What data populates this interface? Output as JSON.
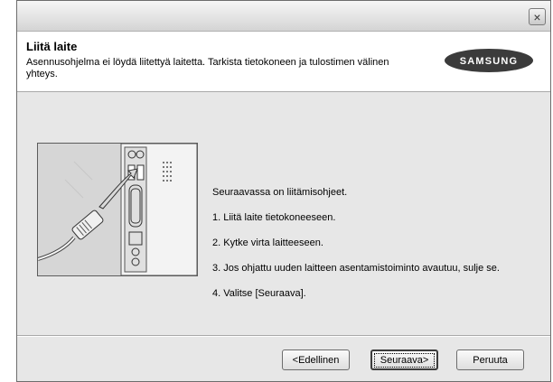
{
  "window": {
    "close_symbol": "×"
  },
  "header": {
    "title": "Liitä laite",
    "description": "Asennusohjelma ei löydä liitettyä laitetta. Tarkista tietokoneen ja tulostimen välinen yhteys.",
    "logo_text": "SAMSUNG"
  },
  "instructions": {
    "intro": "Seuraavassa on liitämisohjeet.",
    "steps": [
      "1. Liitä laite tietokoneeseen.",
      "2. Kytke virta laitteeseen.",
      "3. Jos ohjattu uuden laitteen asentamistoiminto avautuu, sulje se.",
      "4. Valitse [Seuraava]."
    ]
  },
  "buttons": {
    "back": "<Edellinen",
    "next": "Seuraava>",
    "cancel": "Peruuta"
  },
  "colors": {
    "logo_bg": "#3b3b3b",
    "dialog_bg": "#e7e7e7"
  }
}
